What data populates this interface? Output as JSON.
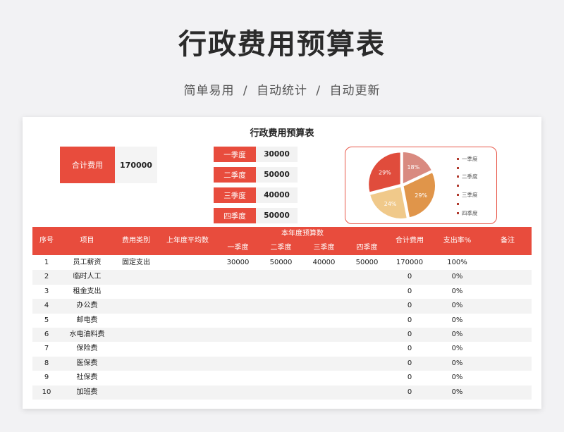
{
  "hero": {
    "title": "行政费用预算表",
    "subtitle": "简单易用  /  自动统计  /  自动更新"
  },
  "sheet": {
    "title": "行政费用预算表",
    "total_label": "合计费用",
    "total_value": "170000",
    "quarters": [
      {
        "label": "一季度",
        "value": "30000"
      },
      {
        "label": "二季度",
        "value": "50000"
      },
      {
        "label": "三季度",
        "value": "40000"
      },
      {
        "label": "四季度",
        "value": "50000"
      }
    ]
  },
  "chart_data": {
    "type": "pie",
    "categories": [
      "一季度",
      "二季度",
      "三季度",
      "四季度"
    ],
    "values": [
      18,
      29,
      24,
      29
    ],
    "value_labels": [
      "18%",
      "29%",
      "24%",
      "29%"
    ],
    "colors": [
      "#d98a80",
      "#e0954a",
      "#f0c98a",
      "#e04c3c"
    ],
    "legend_position": "right",
    "legend_entries": [
      "一季度",
      "",
      "二季度",
      "",
      "三季度",
      "",
      "四季度"
    ]
  },
  "table": {
    "headers": {
      "index": "序号",
      "item": "项目",
      "category": "费用类别",
      "last_year": "上年度平均数",
      "budget_group": "本年度预算数",
      "q1": "一季度",
      "q2": "二季度",
      "q3": "三季度",
      "q4": "四季度",
      "total": "合计费用",
      "rate": "支出率%",
      "note": "备注"
    },
    "rows": [
      {
        "index": "1",
        "item": "员工薪资",
        "category": "固定支出",
        "last_year": "",
        "q1": "30000",
        "q2": "50000",
        "q3": "40000",
        "q4": "50000",
        "total": "170000",
        "rate": "100%",
        "note": ""
      },
      {
        "index": "2",
        "item": "临时人工",
        "category": "",
        "last_year": "",
        "q1": "",
        "q2": "",
        "q3": "",
        "q4": "",
        "total": "0",
        "rate": "0%",
        "note": ""
      },
      {
        "index": "3",
        "item": "租金支出",
        "category": "",
        "last_year": "",
        "q1": "",
        "q2": "",
        "q3": "",
        "q4": "",
        "total": "0",
        "rate": "0%",
        "note": ""
      },
      {
        "index": "4",
        "item": "办公费",
        "category": "",
        "last_year": "",
        "q1": "",
        "q2": "",
        "q3": "",
        "q4": "",
        "total": "0",
        "rate": "0%",
        "note": ""
      },
      {
        "index": "5",
        "item": "邮电费",
        "category": "",
        "last_year": "",
        "q1": "",
        "q2": "",
        "q3": "",
        "q4": "",
        "total": "0",
        "rate": "0%",
        "note": ""
      },
      {
        "index": "6",
        "item": "水电油料费",
        "category": "",
        "last_year": "",
        "q1": "",
        "q2": "",
        "q3": "",
        "q4": "",
        "total": "0",
        "rate": "0%",
        "note": ""
      },
      {
        "index": "7",
        "item": "保险费",
        "category": "",
        "last_year": "",
        "q1": "",
        "q2": "",
        "q3": "",
        "q4": "",
        "total": "0",
        "rate": "0%",
        "note": ""
      },
      {
        "index": "8",
        "item": "医保费",
        "category": "",
        "last_year": "",
        "q1": "",
        "q2": "",
        "q3": "",
        "q4": "",
        "total": "0",
        "rate": "0%",
        "note": ""
      },
      {
        "index": "9",
        "item": "社保费",
        "category": "",
        "last_year": "",
        "q1": "",
        "q2": "",
        "q3": "",
        "q4": "",
        "total": "0",
        "rate": "0%",
        "note": ""
      },
      {
        "index": "10",
        "item": "加班费",
        "category": "",
        "last_year": "",
        "q1": "",
        "q2": "",
        "q3": "",
        "q4": "",
        "total": "0",
        "rate": "0%",
        "note": ""
      }
    ]
  }
}
